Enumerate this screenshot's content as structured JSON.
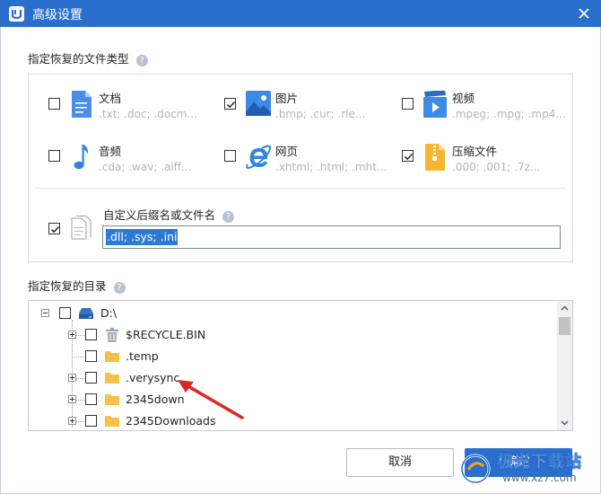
{
  "window": {
    "title": "高级设置",
    "accent_color": "#2b6fce"
  },
  "file_types": {
    "label": "指定恢复的文件类型",
    "help_icon": "?",
    "items": [
      {
        "name": "文档",
        "exts": ".txt; .doc; .docm...",
        "checked": false,
        "icon": "document-icon"
      },
      {
        "name": "图片",
        "exts": ".bmp; .cur; .rle...",
        "checked": true,
        "icon": "picture-icon"
      },
      {
        "name": "视频",
        "exts": ".mpeg; .mpg; .mp4...",
        "checked": false,
        "icon": "video-icon"
      },
      {
        "name": "音频",
        "exts": ".cda; .wav; .aiff...",
        "checked": false,
        "icon": "music-note-icon"
      },
      {
        "name": "网页",
        "exts": ".xhtml; .html; .mht...",
        "checked": false,
        "icon": "browser-e-icon"
      },
      {
        "name": "压缩文件",
        "exts": ".000; .001; .7z...",
        "checked": true,
        "icon": "zip-file-icon"
      }
    ],
    "custom": {
      "label": "自定义后缀名或文件名",
      "checked": true,
      "value": ".dll; .sys; .ini",
      "icon": "files-icon"
    }
  },
  "directories": {
    "label": "指定恢复的目录",
    "help_icon": "?",
    "tree": [
      {
        "label": "D:\\",
        "icon": "drive-icon",
        "expanded": true,
        "checked": false
      },
      {
        "label": "$RECYCLE.BIN",
        "icon": "recycle-bin-icon",
        "expandable": true,
        "checked": false
      },
      {
        "label": ".temp",
        "icon": "folder-icon",
        "expandable": false,
        "checked": false
      },
      {
        "label": ".verysync",
        "icon": "folder-icon",
        "expandable": true,
        "checked": false
      },
      {
        "label": "2345down",
        "icon": "folder-icon",
        "expandable": true,
        "checked": false
      },
      {
        "label": "2345Downloads",
        "icon": "folder-icon",
        "expandable": true,
        "checked": false
      }
    ]
  },
  "buttons": {
    "cancel": "取消",
    "ok": "确定"
  },
  "watermark": {
    "text": "极光下载站",
    "url": "www.xz7.com"
  }
}
